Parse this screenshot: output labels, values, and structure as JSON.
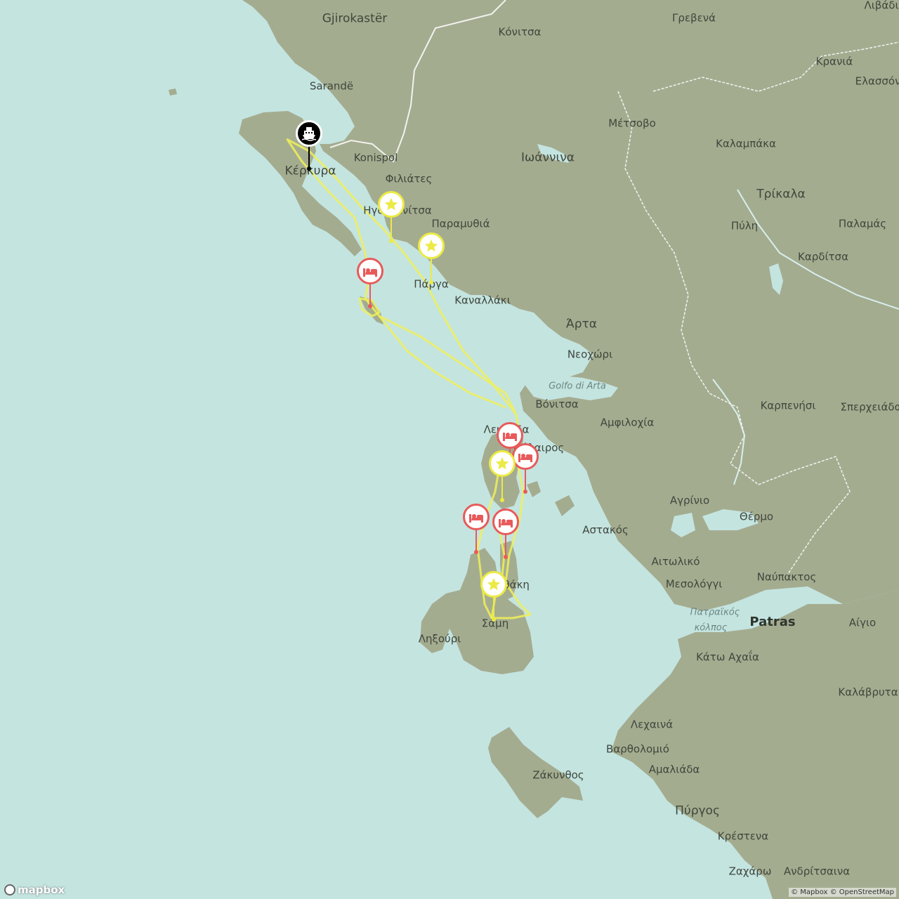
{
  "labels": [
    {
      "id": "gjirokaster",
      "text": "Gjirokastër",
      "cls": "city"
    },
    {
      "id": "konitsa",
      "text": "Κόνιτσα",
      "cls": ""
    },
    {
      "id": "grevena",
      "text": "Γρεβενά",
      "cls": ""
    },
    {
      "id": "livadi",
      "text": "Λιβάδι",
      "cls": ""
    },
    {
      "id": "kraniа",
      "text": "Κρανιά",
      "cls": ""
    },
    {
      "id": "elassona",
      "text": "Ελασσόνα",
      "cls": ""
    },
    {
      "id": "sarande",
      "text": "Sarandë",
      "cls": ""
    },
    {
      "id": "metsovo",
      "text": "Μέτσοβο",
      "cls": ""
    },
    {
      "id": "kalampaka",
      "text": "Καλαμπάκα",
      "cls": ""
    },
    {
      "id": "konispol",
      "text": "Konispol",
      "cls": ""
    },
    {
      "id": "ioannina",
      "text": "Ιωάννινα",
      "cls": "city"
    },
    {
      "id": "kerkyra",
      "text": "Κέρκυρα",
      "cls": "city"
    },
    {
      "id": "filiates",
      "text": "Φιλιάτες",
      "cls": ""
    },
    {
      "id": "trikala",
      "text": "Τρίκαλα",
      "cls": "city"
    },
    {
      "id": "igoumenitsa",
      "text": "Ηγουμενίτσα",
      "cls": ""
    },
    {
      "id": "paramythia",
      "text": "Παραμυθιά",
      "cls": ""
    },
    {
      "id": "pyli",
      "text": "Πύλη",
      "cls": ""
    },
    {
      "id": "palamas",
      "text": "Παλαμάς",
      "cls": ""
    },
    {
      "id": "karditsa",
      "text": "Καρδίτσα",
      "cls": ""
    },
    {
      "id": "parga",
      "text": "Πάργα",
      "cls": ""
    },
    {
      "id": "kanallaki",
      "text": "Καναλλάκι",
      "cls": ""
    },
    {
      "id": "arta",
      "text": "Άρτα",
      "cls": "city"
    },
    {
      "id": "neochori",
      "text": "Νεοχώρι",
      "cls": ""
    },
    {
      "id": "golfo",
      "text": "Golfo di Arta",
      "cls": "water"
    },
    {
      "id": "vonitsa",
      "text": "Βόνιτσα",
      "cls": ""
    },
    {
      "id": "karpenisi",
      "text": "Καρπενήσι",
      "cls": ""
    },
    {
      "id": "spercheiada",
      "text": "Σπερχειάδα",
      "cls": ""
    },
    {
      "id": "amfilochia",
      "text": "Αμφιλοχία",
      "cls": ""
    },
    {
      "id": "lefkada",
      "text": "Λευκάδα",
      "cls": ""
    },
    {
      "id": "palairos",
      "text": "Πάλαιρος",
      "cls": ""
    },
    {
      "id": "agrinio",
      "text": "Αγρίνιο",
      "cls": ""
    },
    {
      "id": "thermo",
      "text": "Θέρμο",
      "cls": ""
    },
    {
      "id": "astakos",
      "text": "Αστακός",
      "cls": ""
    },
    {
      "id": "aitoliko",
      "text": "Αιτωλικό",
      "cls": ""
    },
    {
      "id": "mesolongi",
      "text": "Μεσολόγγι",
      "cls": ""
    },
    {
      "id": "nafpaktos",
      "text": "Ναύπακτος",
      "cls": ""
    },
    {
      "id": "ithaki",
      "text": "Ιθάκη",
      "cls": ""
    },
    {
      "id": "patraikos",
      "text": "Πατραϊκός",
      "cls": "water"
    },
    {
      "id": "kolpos",
      "text": "κόλπος",
      "cls": "water"
    },
    {
      "id": "patras",
      "text": "Patras",
      "cls": "big"
    },
    {
      "id": "aigio",
      "text": "Αίγιο",
      "cls": ""
    },
    {
      "id": "sami",
      "text": "Σάμη",
      "cls": ""
    },
    {
      "id": "lixouri",
      "text": "Ληξούρι",
      "cls": ""
    },
    {
      "id": "kato_achaia",
      "text": "Κάτω Αχαΐα",
      "cls": ""
    },
    {
      "id": "kalavryta",
      "text": "Καλάβρυτα",
      "cls": ""
    },
    {
      "id": "lechaina",
      "text": "Λεχαινά",
      "cls": ""
    },
    {
      "id": "vartholomio",
      "text": "Βαρθολομιό",
      "cls": ""
    },
    {
      "id": "amaliada",
      "text": "Αμαλιάδα",
      "cls": ""
    },
    {
      "id": "zakynthos",
      "text": "Ζάκυνθος",
      "cls": ""
    },
    {
      "id": "pyrgos",
      "text": "Πύργος",
      "cls": "city"
    },
    {
      "id": "krestena",
      "text": "Κρέστενα",
      "cls": ""
    },
    {
      "id": "zacharo",
      "text": "Ζαχάρω",
      "cls": ""
    },
    {
      "id": "andritsaina",
      "text": "Ανδρίτσαινα",
      "cls": ""
    }
  ],
  "markers": [
    {
      "id": "ferry",
      "type": "ferry",
      "icon": "ferry-icon",
      "color": "#000000"
    },
    {
      "id": "poi1",
      "type": "star",
      "icon": "star-icon",
      "color": "#ecea45"
    },
    {
      "id": "poi2",
      "type": "star",
      "icon": "star-icon",
      "color": "#ecea45"
    },
    {
      "id": "stay1",
      "type": "bed",
      "icon": "bed-icon",
      "color": "#e85a5a"
    },
    {
      "id": "stay2",
      "type": "bed",
      "icon": "bed-icon",
      "color": "#e85a5a"
    },
    {
      "id": "stay3",
      "type": "bed",
      "icon": "bed-icon",
      "color": "#e85a5a"
    },
    {
      "id": "poi3",
      "type": "star",
      "icon": "star-icon",
      "color": "#ecea45"
    },
    {
      "id": "stay4",
      "type": "bed",
      "icon": "bed-icon",
      "color": "#e85a5a"
    },
    {
      "id": "stay5",
      "type": "bed",
      "icon": "bed-icon",
      "color": "#e85a5a"
    },
    {
      "id": "poi4",
      "type": "star",
      "icon": "star-icon",
      "color": "#ecea45"
    }
  ],
  "route_color": "#f0f05a",
  "attribution": "© Mapbox © OpenStreetMap",
  "logo_text": "mapbox"
}
